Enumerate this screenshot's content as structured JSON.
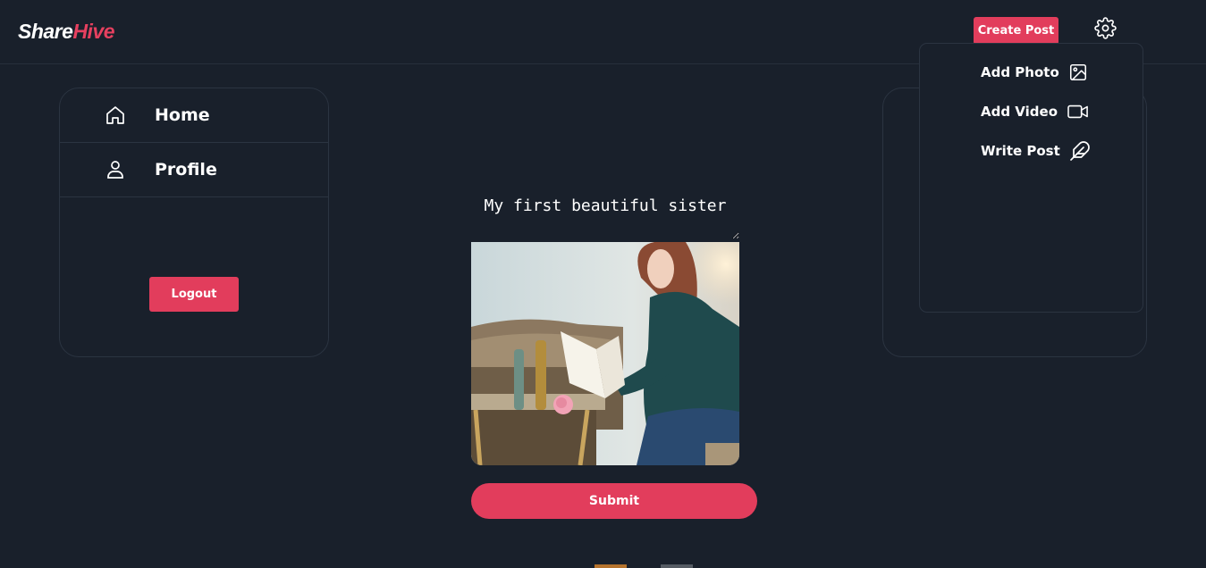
{
  "header": {
    "logo_part1": "Share",
    "logo_part2": "Hive",
    "create_post_label": "Create Post",
    "settings_icon": "gear-icon"
  },
  "dropdown": {
    "items": [
      {
        "label": "Add Photo",
        "icon": "image-icon"
      },
      {
        "label": "Add Video",
        "icon": "video-camera-icon"
      },
      {
        "label": "Write Post",
        "icon": "feather-icon"
      }
    ]
  },
  "sidebar": {
    "items": [
      {
        "label": "Home",
        "icon": "home-icon"
      },
      {
        "label": "Profile",
        "icon": "user-icon"
      }
    ],
    "logout_label": "Logout"
  },
  "post_form": {
    "caption_value": "My first beautiful sister",
    "submit_label": "Submit"
  },
  "colors": {
    "background": "#19202b",
    "accent": "#e23d5c",
    "border": "#2b3441",
    "text": "#ffffff"
  }
}
